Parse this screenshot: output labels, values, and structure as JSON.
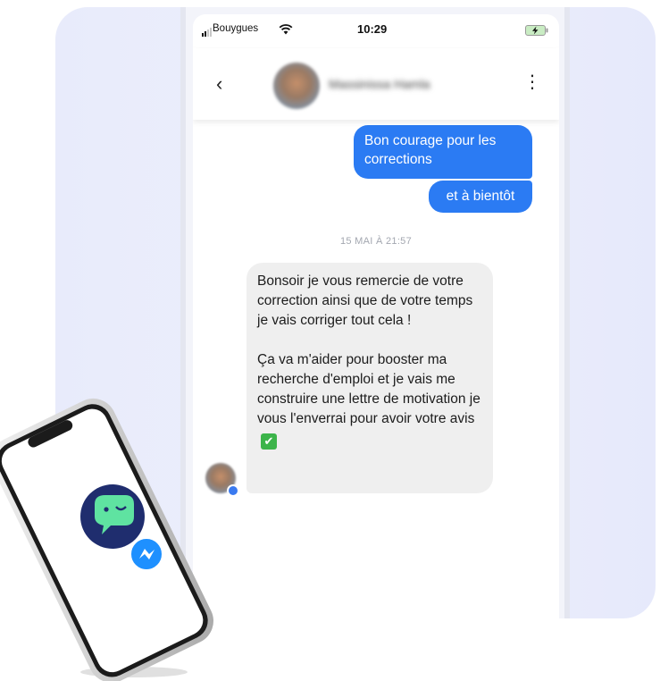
{
  "status_bar": {
    "carrier": "Bouygues",
    "time": "10:29",
    "icons": [
      "signal-icon",
      "wifi-icon",
      "battery-charging-icon"
    ]
  },
  "header": {
    "back_icon": "back-chevron-icon",
    "contact_name": "Massinissa Hamla",
    "menu_icon": "kebab-menu-icon"
  },
  "messages": {
    "outgoing_1": "Bon courage pour les corrections",
    "outgoing_2": "et à bientôt",
    "timestamp": "15 MAI À 21:57",
    "incoming_p1": "Bonsoir je vous remercie de votre correction ainsi que de votre temps je vais corriger tout cela !",
    "incoming_p2": "Ça va m'aider pour booster ma recherche d'emploi et je vais me construire une lettre de motivation je vous l'enverrai pour avoir votre avis",
    "incoming_emoji": "white-check-mark-icon"
  },
  "colors": {
    "outgoing_bubble": "#2b7bf3",
    "incoming_bubble": "#efefef",
    "app_logo_circle": "#1f2d6e",
    "app_logo_bubble": "#5fe3a1",
    "messenger_badge": "#1e90ff"
  },
  "illustration": {
    "icons": [
      "chat-app-logo-icon",
      "messenger-icon"
    ]
  }
}
